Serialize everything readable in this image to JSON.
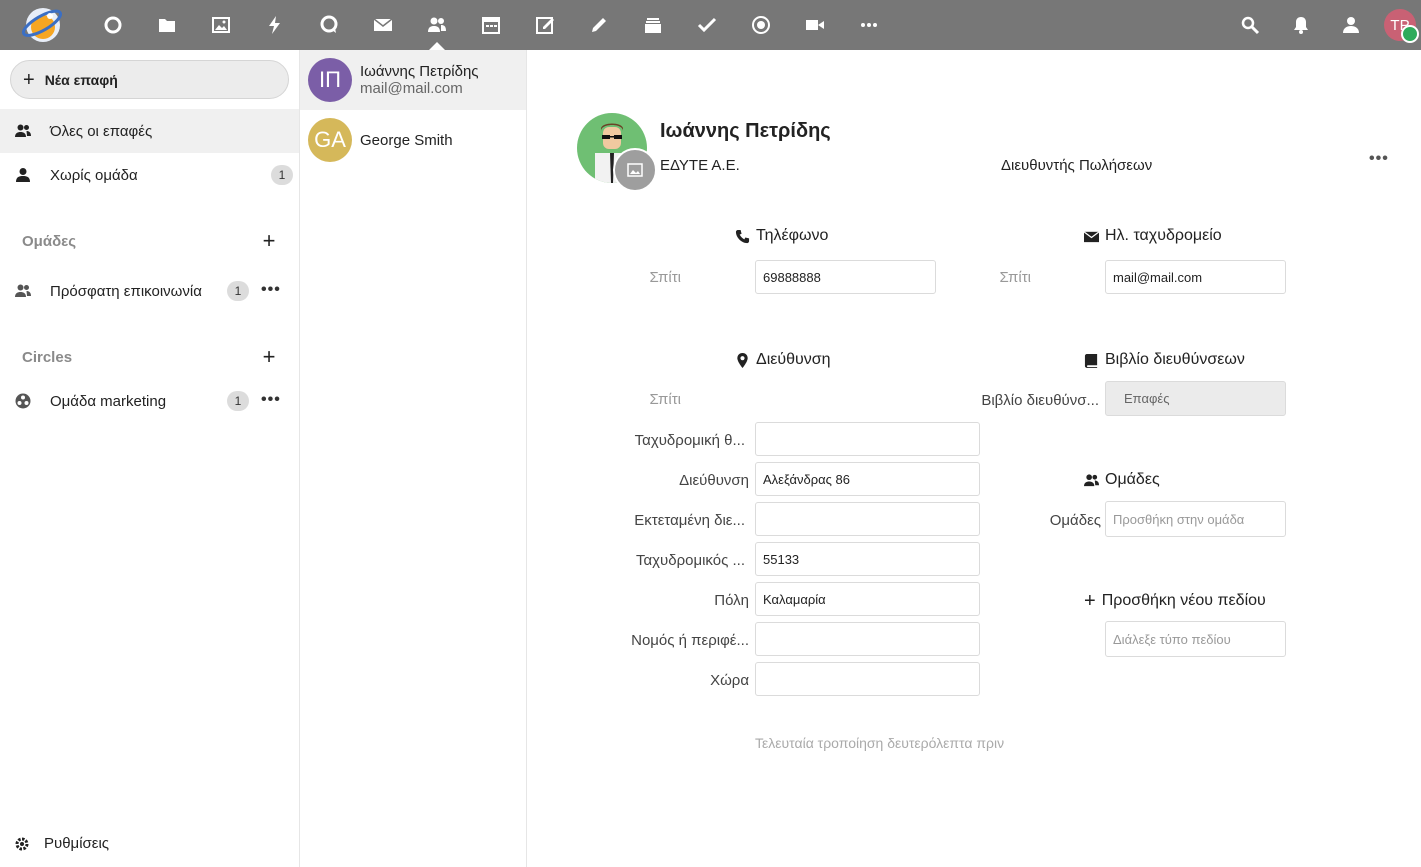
{
  "header": {
    "user_initials": "TP",
    "apps": [
      "dashboard-icon",
      "files-icon",
      "photos-icon",
      "activity-icon",
      "talk-icon",
      "mail-icon",
      "contacts-icon",
      "calendar-icon",
      "notes-icon",
      "text-icon",
      "deck-icon",
      "tasks-icon",
      "circles-icon",
      "video-icon",
      "more-icon"
    ],
    "colors": {
      "bar": "#777777",
      "avatar": "#c96174",
      "status": "#2eab5b"
    }
  },
  "nav": {
    "new_contact_label": "Νέα επαφή",
    "items": [
      {
        "label": "Όλες οι επαφές"
      },
      {
        "label": "Χωρίς ομάδα",
        "count": "1"
      }
    ],
    "groups_caption": "Ομάδες",
    "groups": [
      {
        "label": "Πρόσφατη επικοινωνία",
        "count": "1"
      }
    ],
    "circles_caption": "Circles",
    "circles": [
      {
        "label": "Ομάδα marketing",
        "count": "1"
      }
    ],
    "settings_label": "Ρυθμίσεις"
  },
  "contacts": [
    {
      "initials": "ΙΠ",
      "name": "Ιωάννης Πετρίδης",
      "email": "mail@mail.com",
      "color": "#7b5ea7"
    },
    {
      "initials": "GA",
      "name": "George Smith",
      "email": "",
      "color": "#d5b85a"
    }
  ],
  "details": {
    "full_name": "Ιωάννης Πετρίδης",
    "organization": "ΕΔΥΤΕ Α.Ε.",
    "title": "Διευθυντής Πωλήσεων",
    "phone": {
      "heading": "Τηλέφωνο",
      "type_label": "Σπίτι",
      "value": "69888888"
    },
    "email": {
      "heading": "Ηλ. ταχυδρομείο",
      "type_label": "Σπίτι",
      "value": "mail@mail.com"
    },
    "address": {
      "heading": "Διεύθυνση",
      "type_label": "Σπίτι",
      "fields": [
        {
          "label": "Ταχυδρομική θ...",
          "value": ""
        },
        {
          "label": "Διεύθυνση",
          "value": "Αλεξάνδρας 86"
        },
        {
          "label": "Εκτεταμένη διε...",
          "value": ""
        },
        {
          "label": "Ταχυδρομικός ...",
          "value": "55133"
        },
        {
          "label": "Πόλη",
          "value": "Καλαμαρία"
        },
        {
          "label": "Νομός ή περιφέ...",
          "value": ""
        },
        {
          "label": "Χώρα",
          "value": ""
        }
      ]
    },
    "addressbook": {
      "heading": "Βιβλίο διευθύνσεων",
      "label": "Βιβλίο διευθύνσ...",
      "value": "Επαφές"
    },
    "groups": {
      "heading": "Ομάδες",
      "label": "Ομάδες",
      "placeholder": "Προσθήκη στην ομάδα"
    },
    "new_field": {
      "heading": "Προσθήκη νέου πεδίου",
      "placeholder": "Διάλεξε τύπο πεδίου"
    },
    "modified_text": "Τελευταία τροποίηση δευτερόλεπτα πριν"
  }
}
